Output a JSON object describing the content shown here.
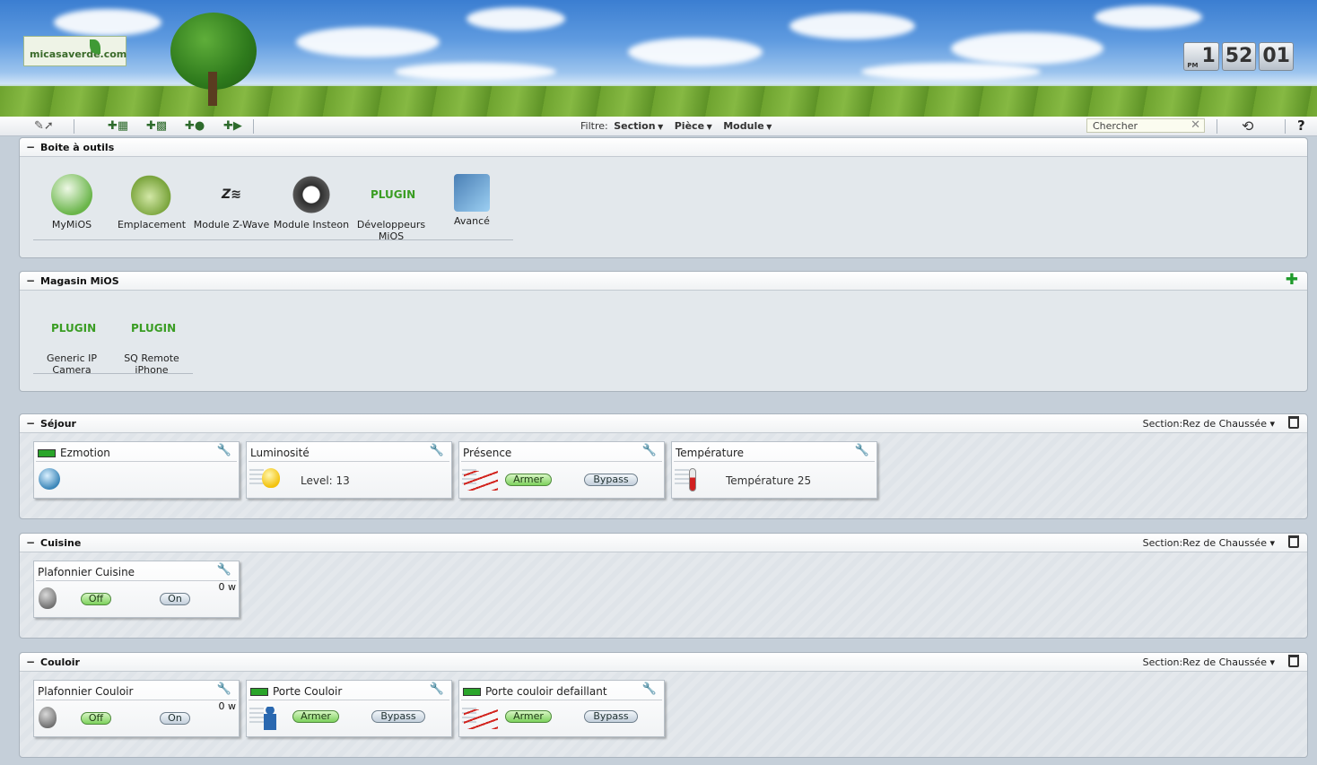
{
  "header": {
    "logo_text": "micasaverde.com",
    "clock": {
      "ampm": "PM",
      "hour": "1",
      "minute": "52",
      "second": "01"
    }
  },
  "toolbar": {
    "filter_label": "Filtre:",
    "filters": [
      "Section",
      "Pièce",
      "Module"
    ],
    "search_placeholder": "Chercher",
    "help": "?"
  },
  "toolbox": {
    "title": "Boite à outils",
    "items": [
      {
        "label": "MyMiOS",
        "icon": "home-icon"
      },
      {
        "label": "Emplacement",
        "icon": "globe-signpost-icon"
      },
      {
        "label": "Module Z-Wave",
        "icon": "zwave-icon"
      },
      {
        "label": "Module Insteon",
        "icon": "insteon-icon"
      },
      {
        "label": "Développeurs MiOS",
        "icon": "plugin-icon",
        "icon_text": "PLUGIN"
      },
      {
        "label": "Avancé",
        "icon": "magnifier-icon"
      }
    ]
  },
  "store": {
    "title": "Magasin MiOS",
    "items": [
      {
        "label": "Generic IP Camera",
        "icon_text": "PLUGIN"
      },
      {
        "label": "SQ Remote iPhone",
        "icon_text": "PLUGIN"
      }
    ]
  },
  "rooms": [
    {
      "title": "Séjour",
      "section_label": "Section:",
      "section_value": "Rez de Chaussée",
      "devices": [
        {
          "name": "Ezmotion",
          "battery": true,
          "icon": "motion-sensor-icon"
        },
        {
          "name": "Luminosité",
          "text": "Level: 13",
          "icon": "bulb-icon"
        },
        {
          "name": "Présence",
          "arm": "Armer",
          "bypass": "Bypass",
          "icon": "laser-icon"
        },
        {
          "name": "Température",
          "text": "Température 25",
          "icon": "thermometer-icon"
        }
      ]
    },
    {
      "title": "Cuisine",
      "section_label": "Section:",
      "section_value": "Rez de Chaussée",
      "devices": [
        {
          "name": "Plafonnier Cuisine",
          "off": "Off",
          "on": "On",
          "watt": "0 w",
          "icon": "bulb-off-icon"
        }
      ]
    },
    {
      "title": "Couloir",
      "section_label": "Section:",
      "section_value": "Rez de Chaussée",
      "devices": [
        {
          "name": "Plafonnier Couloir",
          "off": "Off",
          "on": "On",
          "watt": "0 w",
          "icon": "bulb-off-icon"
        },
        {
          "name": "Porte Couloir",
          "battery": true,
          "arm": "Armer",
          "bypass": "Bypass",
          "icon": "person-icon"
        },
        {
          "name": "Porte couloir defaillant",
          "battery": true,
          "arm": "Armer",
          "bypass": "Bypass",
          "icon": "laser-icon"
        }
      ]
    }
  ]
}
